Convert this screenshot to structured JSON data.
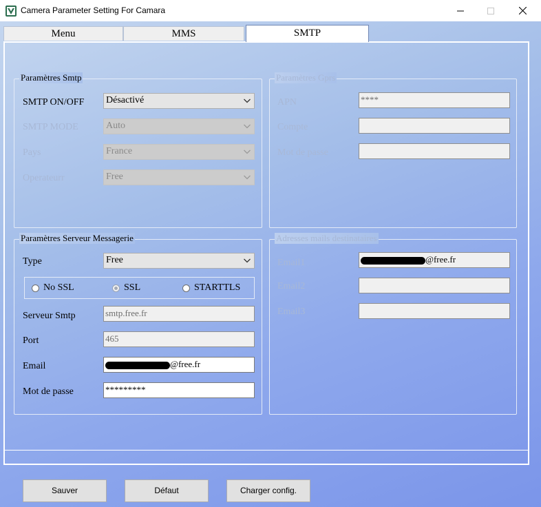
{
  "window": {
    "title": "Camera Parameter Setting For  Camara"
  },
  "tabs": [
    "Menu",
    "MMS",
    "SMTP"
  ],
  "smtp_params": {
    "legend": "Paramètres Smtp",
    "on_off_label": "SMTP ON/OFF",
    "on_off_value": "Désactivé",
    "mode_label": "SMTP MODE",
    "mode_value": "Auto",
    "country_label": "Pays",
    "country_value": "France",
    "operator_label": "Operateurr",
    "operator_value": "Free"
  },
  "gprs_params": {
    "legend": "Paramètres Gprs",
    "apn_label": "APN",
    "apn_value": "****",
    "account_label": "Compte",
    "account_value": "",
    "password_label": "Mot de passe",
    "password_value": ""
  },
  "mail_server": {
    "legend": "Paramètres Serveur Messagerie",
    "type_label": "Type",
    "type_value": "Free",
    "ssl_options": [
      "No SSL",
      "SSL",
      "STARTTLS"
    ],
    "selected_ssl": "SSL",
    "server_label": "Serveur Smtp",
    "server_value": "smtp.free.fr",
    "port_label": "Port",
    "port_value": "465",
    "email_label": "Email",
    "email_value": "@free.fr",
    "password_label": "Mot de passe",
    "password_value": "*********"
  },
  "recipients": {
    "legend": "Adresses mails destinataires",
    "email1_label": "Email1",
    "email1_value": "@free.fr",
    "email2_label": "Email2",
    "email2_value": "",
    "email3_label": "Email3",
    "email3_value": ""
  },
  "buttons": {
    "save": "Sauver",
    "default": "Défaut",
    "load": "Charger config."
  }
}
